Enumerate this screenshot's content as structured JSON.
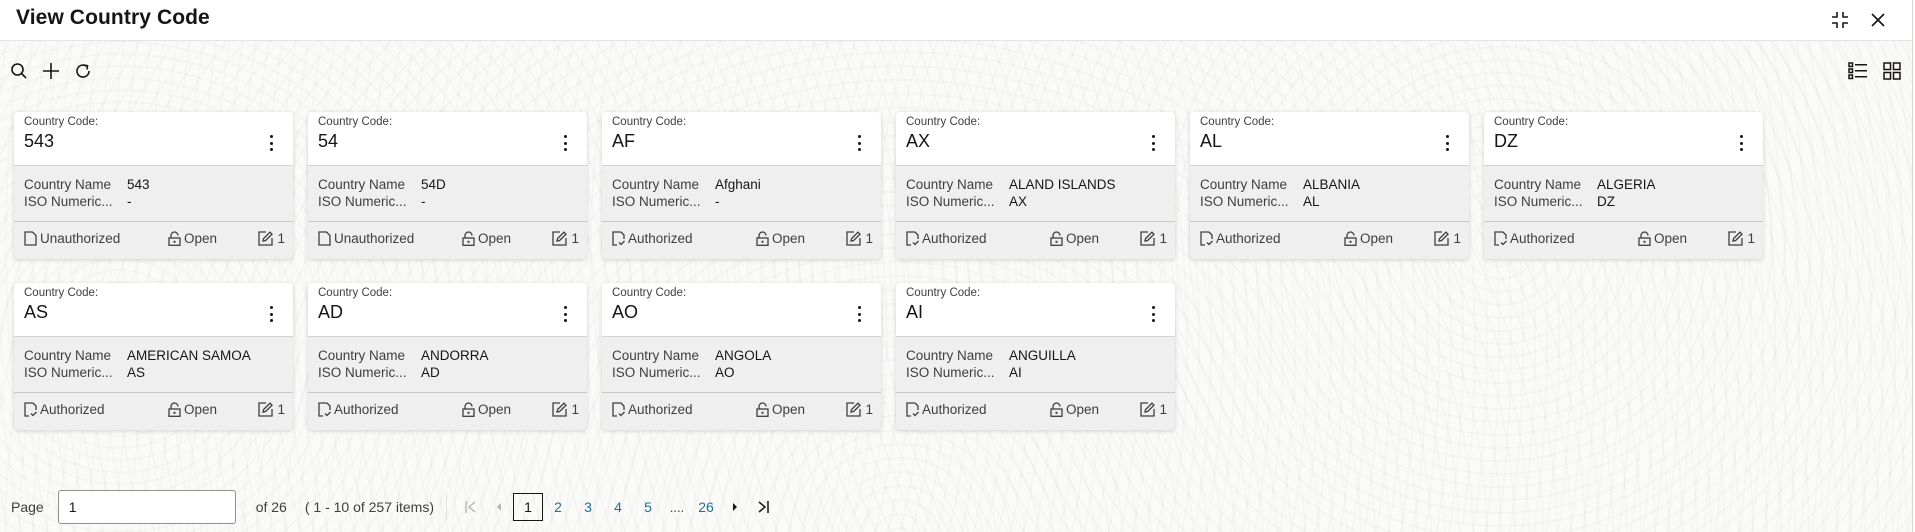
{
  "header": {
    "title": "View Country Code",
    "icons": {
      "minimize": "compress-icon",
      "close": "close-icon"
    }
  },
  "toolbar": {
    "icons": [
      "search-icon",
      "add-icon",
      "refresh-icon"
    ]
  },
  "view_toggle": {
    "list": "list-view-icon",
    "grid": "grid-view-icon"
  },
  "card_labels": {
    "code_label": "Country Code:",
    "name_label": "Country Name",
    "iso_label": "ISO Numeric..."
  },
  "cards": [
    {
      "code": "543",
      "country_name": "543",
      "iso_numeric": "-",
      "status": "Unauthorized",
      "lock": "Open",
      "version": "1"
    },
    {
      "code": "54",
      "country_name": "54D",
      "iso_numeric": "-",
      "status": "Unauthorized",
      "lock": "Open",
      "version": "1"
    },
    {
      "code": "AF",
      "country_name": "Afghani",
      "iso_numeric": "-",
      "status": "Authorized",
      "lock": "Open",
      "version": "1"
    },
    {
      "code": "AX",
      "country_name": "ALAND ISLANDS",
      "iso_numeric": "AX",
      "status": "Authorized",
      "lock": "Open",
      "version": "1"
    },
    {
      "code": "AL",
      "country_name": "ALBANIA",
      "iso_numeric": "AL",
      "status": "Authorized",
      "lock": "Open",
      "version": "1"
    },
    {
      "code": "DZ",
      "country_name": "ALGERIA",
      "iso_numeric": "DZ",
      "status": "Authorized",
      "lock": "Open",
      "version": "1"
    },
    {
      "code": "AS",
      "country_name": "AMERICAN SAMOA",
      "iso_numeric": "AS",
      "status": "Authorized",
      "lock": "Open",
      "version": "1"
    },
    {
      "code": "AD",
      "country_name": "ANDORRA",
      "iso_numeric": "AD",
      "status": "Authorized",
      "lock": "Open",
      "version": "1"
    },
    {
      "code": "AO",
      "country_name": "ANGOLA",
      "iso_numeric": "AO",
      "status": "Authorized",
      "lock": "Open",
      "version": "1"
    },
    {
      "code": "AI",
      "country_name": "ANGUILLA",
      "iso_numeric": "AI",
      "status": "Authorized",
      "lock": "Open",
      "version": "1"
    }
  ],
  "pagination": {
    "page_label": "Page",
    "current_page": "1",
    "of_label": "of 26",
    "range_label": "( 1 - 10 of 257 items)",
    "pages": [
      "1",
      "2",
      "3",
      "4",
      "5"
    ],
    "ellipsis": "....",
    "last_page": "26"
  },
  "colors": {
    "link": "#227094",
    "text": "#161513",
    "card_body_bg": "#efefef"
  }
}
